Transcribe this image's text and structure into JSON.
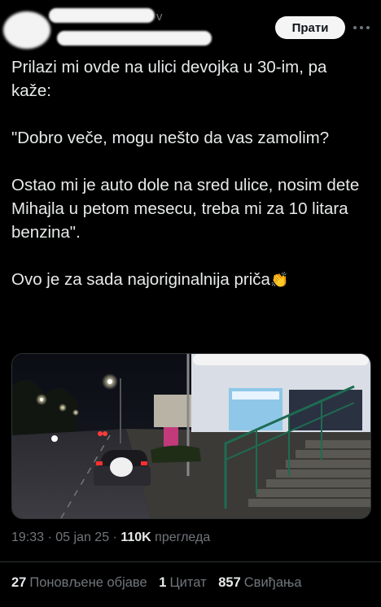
{
  "header": {
    "handle_fragment": "v",
    "follow_label": "Прати"
  },
  "tweet": {
    "line1": "Prilazi mi  ovde na ulici devojka u 30-im, pa kaže:",
    "line2": "\"Dobro veče, mogu nešto da vas zamolim?",
    "line3": " Ostao mi je auto dole na sred ulice, nosim dete Mihajla u petom mesecu, treba mi za 10 litara benzina\".",
    "line4": "Ovo je za sada najoriginalnija priča",
    "emoji": "👏"
  },
  "meta": {
    "time": "19:33",
    "sep1": " · ",
    "date": "05 jan 25",
    "sep2": " · ",
    "views": "110K",
    "views_label": " прегледа"
  },
  "stats": {
    "reposts_count": "27",
    "reposts_label": "Поновљене објаве",
    "quotes_count": "1",
    "quotes_label": "Цитат",
    "likes_count": "857",
    "likes_label": "Свиђања"
  }
}
